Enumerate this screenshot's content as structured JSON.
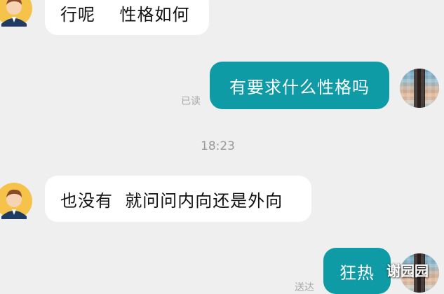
{
  "messages": [
    {
      "side": "left",
      "text": "行呢    性格如何"
    },
    {
      "side": "right",
      "text": "有要求什么性格吗",
      "status": "已读"
    },
    {
      "time": "18:23"
    },
    {
      "side": "left",
      "text": "也没有  就问问内向还是外向"
    },
    {
      "side": "right",
      "text": "狂热",
      "status": "送达"
    }
  ],
  "watermark": "谢园园",
  "colors": {
    "background": "#efefef",
    "outgoing_bubble": "#0e9ba6",
    "incoming_bubble": "#ffffff"
  },
  "icons": {
    "incoming_avatar": "cartoon-man-avatar-icon",
    "outgoing_avatar": "pixelated-photo-avatar-icon"
  }
}
